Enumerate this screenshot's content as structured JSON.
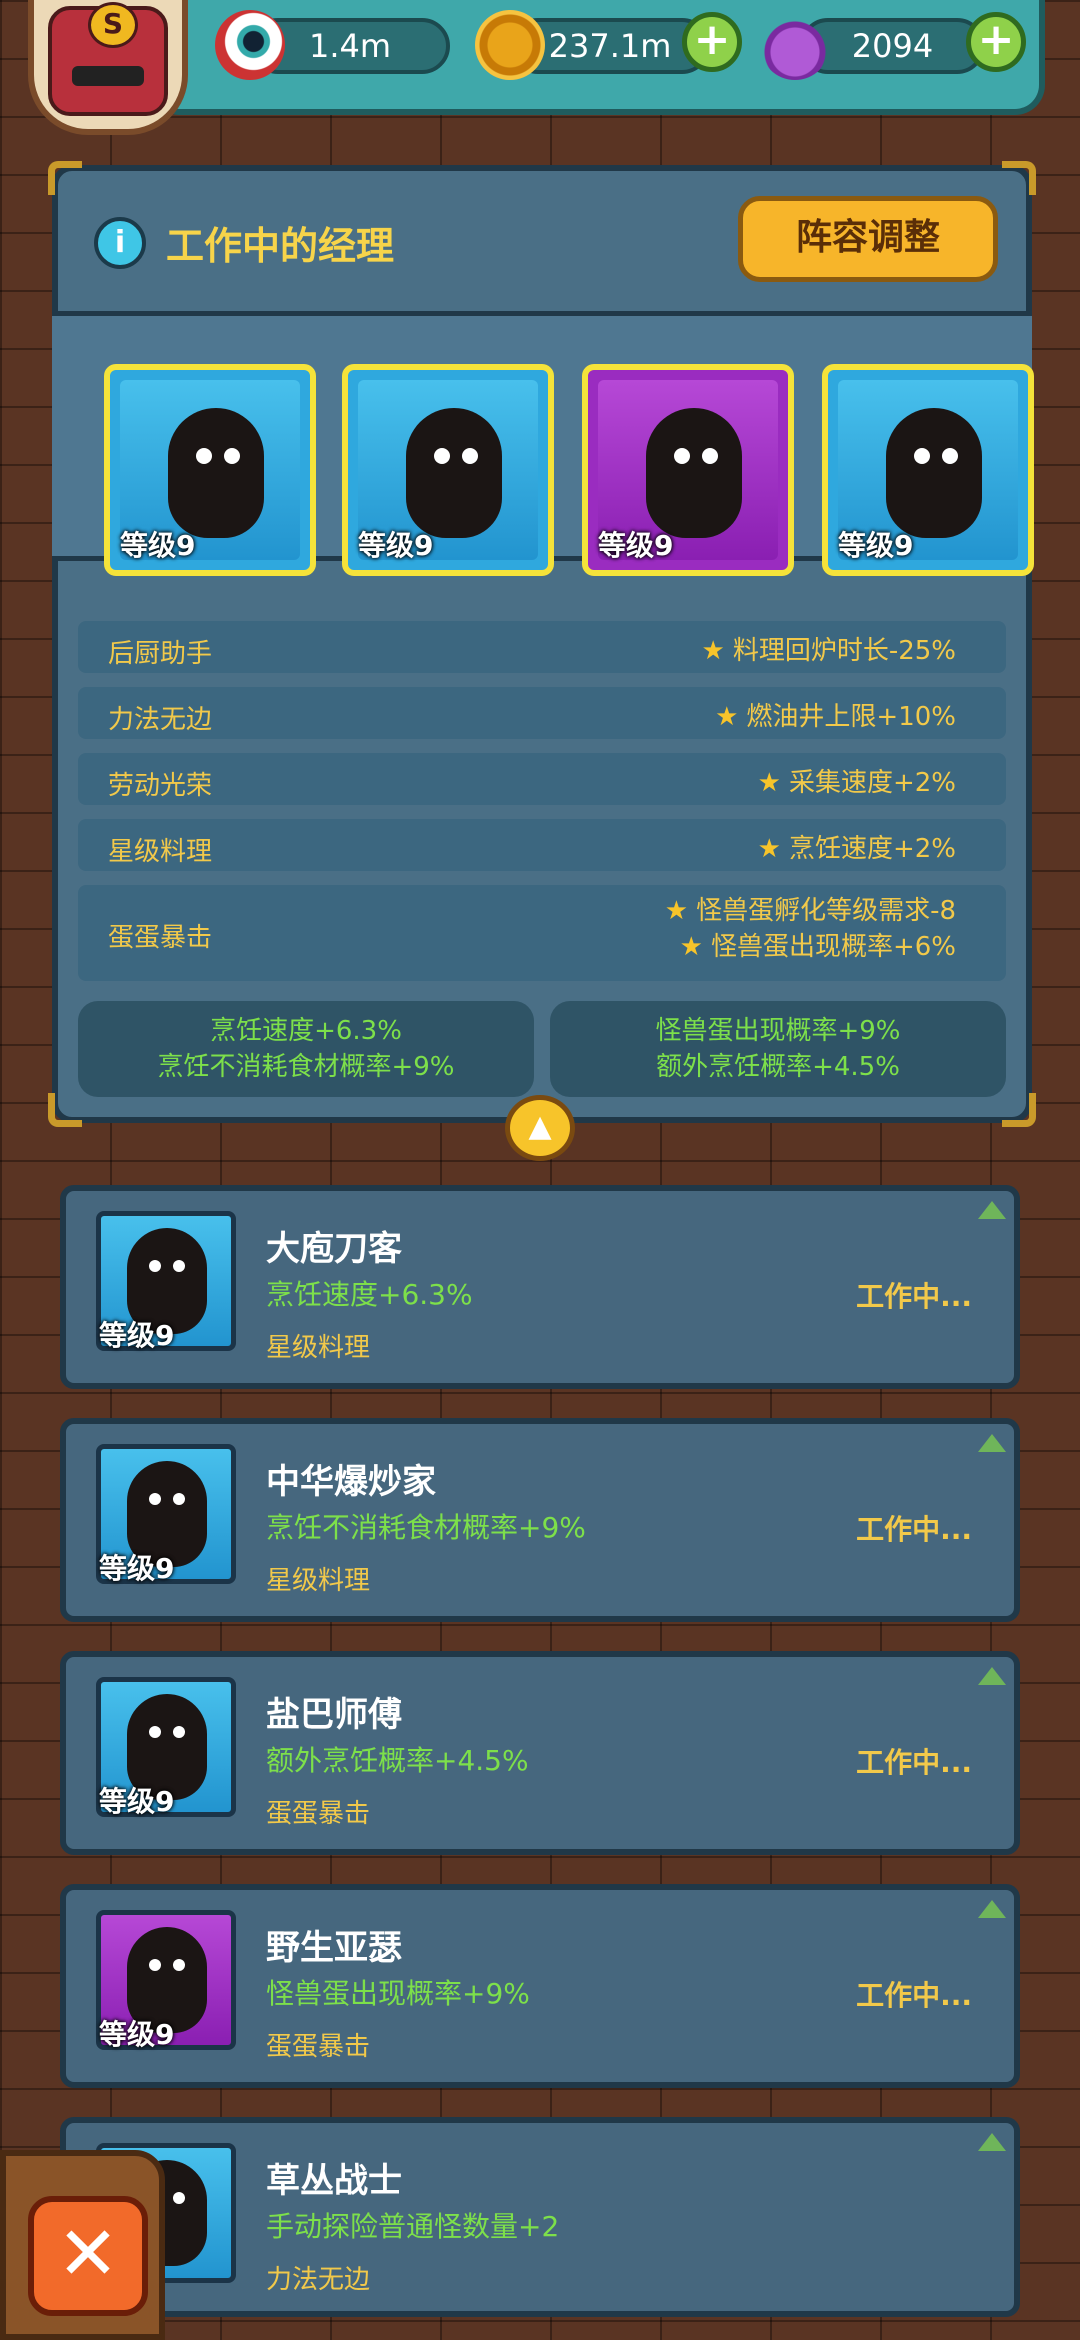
{
  "resources": {
    "eyes": {
      "value": "1.4m",
      "icon": "eyeball-icon"
    },
    "coins": {
      "value": "237.1m",
      "icon": "coin-icon"
    },
    "potions": {
      "value": "2094",
      "icon": "potion-icon"
    },
    "badge_letter": "S"
  },
  "panel": {
    "title": "工作中的经理",
    "lineup_button": "阵容调整",
    "slots": [
      {
        "level": "等级9",
        "color": "#2fa8de"
      },
      {
        "level": "等级9",
        "color": "#2fa8de"
      },
      {
        "level": "等级9",
        "color": "#9a2cc0"
      },
      {
        "level": "等级9",
        "color": "#2fa8de"
      }
    ],
    "skills": [
      {
        "name": "后厨助手",
        "effects": [
          "料理回炉时长-25%"
        ]
      },
      {
        "name": "力法无边",
        "effects": [
          "燃油井上限+10%"
        ]
      },
      {
        "name": "劳动光荣",
        "effects": [
          "采集速度+2%"
        ]
      },
      {
        "name": "星级料理",
        "effects": [
          "烹饪速度+2%"
        ]
      },
      {
        "name": "蛋蛋暴击",
        "effects": [
          "怪兽蛋孵化等级需求-8",
          "怪兽蛋出现概率+6%"
        ]
      }
    ],
    "summary_left": [
      "烹饪速度+6.3%",
      "烹饪不消耗食材概率+9%"
    ],
    "summary_right": [
      "怪兽蛋出现概率+9%",
      "额外烹饪概率+4.5%"
    ]
  },
  "managers": [
    {
      "name": "大庖刀客",
      "bonus": "烹饪速度+6.3%",
      "skill": "星级料理",
      "level": "等级9",
      "status": "工作中...",
      "color": "#2fa8de"
    },
    {
      "name": "中华爆炒家",
      "bonus": "烹饪不消耗食材概率+9%",
      "skill": "星级料理",
      "level": "等级9",
      "status": "工作中...",
      "color": "#2fa8de"
    },
    {
      "name": "盐巴师傅",
      "bonus": "额外烹饪概率+4.5%",
      "skill": "蛋蛋暴击",
      "level": "等级9",
      "status": "工作中...",
      "color": "#2fa8de"
    },
    {
      "name": "野生亚瑟",
      "bonus": "怪兽蛋出现概率+9%",
      "skill": "蛋蛋暴击",
      "level": "等级9",
      "status": "工作中...",
      "color": "#9a2cc0"
    },
    {
      "name": "草丛战士",
      "bonus": "手动探险普通怪数量+2",
      "skill": "力法无边",
      "level": "",
      "status": "",
      "color": "#2fa8de"
    }
  ],
  "close_icon": "close-x-icon"
}
